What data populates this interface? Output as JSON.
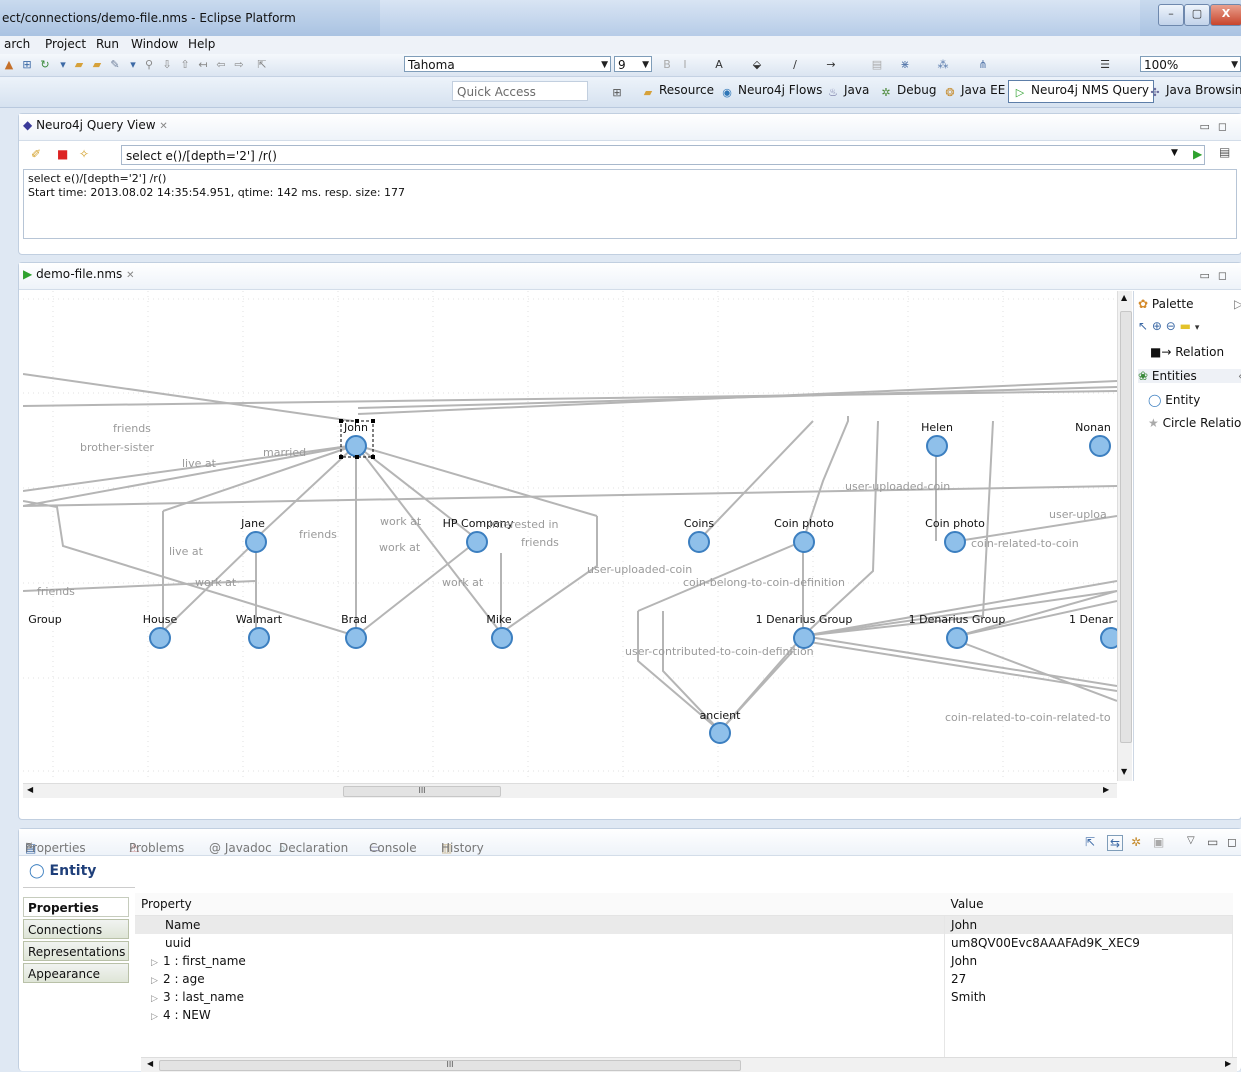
{
  "window": {
    "title": "ect/connections/demo-file.nms - Eclipse Platform",
    "min_label": "–",
    "max_label": "▢",
    "close_label": "X"
  },
  "menu": [
    "arch",
    "Project",
    "Run",
    "Window",
    "Help"
  ],
  "toolbar": {
    "font_family": "Tahoma",
    "font_size": "9",
    "zoom": "100%",
    "quick_access_placeholder": "Quick Access"
  },
  "perspectives": [
    {
      "label": "Resource",
      "icon": "resource-icon"
    },
    {
      "label": "Neuro4j Flows",
      "icon": "flows-icon"
    },
    {
      "label": "Java",
      "icon": "java-icon"
    },
    {
      "label": "Debug",
      "icon": "debug-icon"
    },
    {
      "label": "Java EE",
      "icon": "javaee-icon"
    },
    {
      "label": "Neuro4j NMS Query",
      "icon": "play-icon",
      "active": true
    },
    {
      "label": "Java Browsing",
      "icon": "browsing-icon"
    }
  ],
  "query_view": {
    "tab_label": "Neuro4j Query View",
    "query": "select e()/[depth='2'] /r()",
    "output_line1": "select e()/[depth='2'] /r()",
    "output_line2": "Start time: 2013.08.02 14:35:54.951, qtime: 142 ms. resp. size: 177"
  },
  "editor": {
    "tab_label": "demo-file.nms"
  },
  "graph": {
    "nodes": [
      "John",
      "Helen",
      "Nonan",
      "Jane",
      "HP Company",
      "Coins",
      "Coin photo",
      "Coin photo",
      "Group",
      "House",
      "Walmart",
      "Brad",
      "Mike",
      "1 Denarius Group",
      "1 Denarius Group",
      "1 Denar",
      "ancient"
    ],
    "edge_labels": [
      "friends",
      "brother-sister",
      "live at",
      "married",
      "work at",
      "work at",
      "friends",
      "interested in",
      "friends",
      "live at",
      "work at",
      "friends",
      "work at",
      "user-uploaded-coin",
      "coin-belong-to-coin-definition",
      "user-uploaded-coin",
      "user-uploa",
      "coin-related-to-coin",
      "user-contributed-to-coin-definition",
      "coin-related-to-coin-related-to"
    ]
  },
  "palette": {
    "title": "Palette",
    "relation": "Relation",
    "entities_group": "Entities",
    "entity": "Entity",
    "circle_relation": "Circle Relation"
  },
  "properties": {
    "tabs": [
      "Properties",
      "Problems",
      "@ Javadoc",
      "Declaration",
      "Console",
      "History"
    ],
    "header": "Entity",
    "side_tabs": [
      "Properties",
      "Connections",
      "Representations",
      "Appearance"
    ],
    "columns": [
      "Property",
      "Value"
    ],
    "rows": [
      {
        "property": "Name",
        "value": "John",
        "expandable": false
      },
      {
        "property": "uuid",
        "value": "um8QV00Evc8AAAFAd9K_XEC9",
        "expandable": false
      },
      {
        "property": "1 : first_name",
        "value": "John",
        "expandable": true
      },
      {
        "property": "2 : age",
        "value": "27",
        "expandable": true
      },
      {
        "property": "3 : last_name",
        "value": "Smith",
        "expandable": true
      },
      {
        "property": "4 : NEW",
        "value": "",
        "expandable": true
      }
    ],
    "hscroll_label": "III"
  },
  "colors": {
    "node_fill": "#7fb6e6",
    "node_stroke": "#3c7fc0",
    "edge": "#b5b5b5",
    "edge_label": "#9a9a9a"
  }
}
